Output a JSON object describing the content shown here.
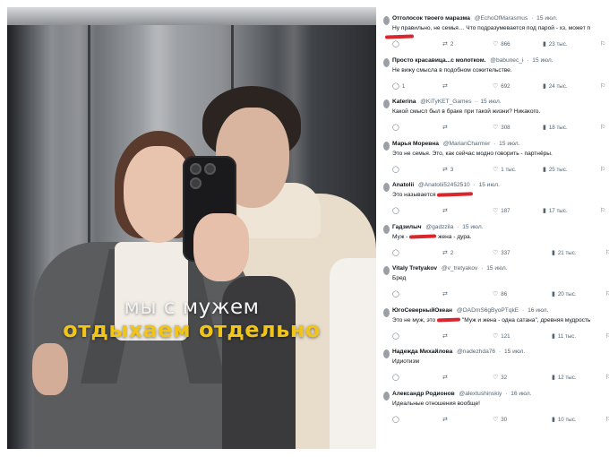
{
  "photo": {
    "caption_line1": "мы с мужем",
    "caption_line2": "отдыхаем отдельно",
    "accent_color": "#f0c419"
  },
  "replies": [
    {
      "name": "Отголосок твоего маразма",
      "handle": "@EchoOfMarasmus",
      "time": "15 июл.",
      "text": "Ну правильно, не семья… Что подразумевается под парой - хз, может п",
      "redacted": true,
      "comments": "",
      "reposts": "2",
      "likes": "866",
      "views": "23 тыс."
    },
    {
      "name": "Просто красавица...с молотком.",
      "handle": "@babunec_i",
      "time": "15 июл.",
      "text": "Не вижу смысла в подобном сожительстве.",
      "comments": "1",
      "reposts": "",
      "likes": "692",
      "views": "24 тыс."
    },
    {
      "name": "Katerina",
      "handle": "@KiTyKET_Games",
      "time": "15 июл.",
      "text": "Какой смысл был в браке при такой жизни? Никакого.",
      "comments": "",
      "reposts": "",
      "likes": "308",
      "views": "18 тыс."
    },
    {
      "name": "Марья Моревна",
      "handle": "@MarianCharmer",
      "time": "15 июл.",
      "text": "Это не семья. Это, как сейчас модно говорить - партнёры.",
      "comments": "",
      "reposts": "3",
      "likes": "1 тыс.",
      "views": "25 тыс."
    },
    {
      "name": "Anatolii",
      "handle": "@Anatolii52452510",
      "time": "15 июл.",
      "text": "Это называется",
      "redacted": true,
      "comments": "",
      "reposts": "",
      "likes": "187",
      "views": "17 тыс."
    },
    {
      "name": "Гадзилыч",
      "handle": "@gadzzila",
      "time": "15 июл.",
      "text": "Муж -",
      "redacted": true,
      "text_after": "жена - дура.",
      "comments": "",
      "reposts": "2",
      "likes": "337",
      "views": "21 тыс."
    },
    {
      "name": "Vitaly Tretyakov",
      "handle": "@v_tretyakov",
      "time": "15 июл.",
      "text": "Бред",
      "comments": "",
      "reposts": "",
      "likes": "86",
      "views": "20 тыс."
    },
    {
      "name": "ЮгоСеверныйОкеан",
      "handle": "@OADmS6gByoPTqkE",
      "time": "16 июл.",
      "text": "Это не муж, это",
      "redacted": true,
      "text_after": "\"Муж и жена - одна сатана\", древняя мудрость",
      "comments": "",
      "reposts": "",
      "likes": "121",
      "views": "11 тыс."
    },
    {
      "name": "Надежда Михайлова",
      "handle": "@nadezhda76",
      "time": "15 июл.",
      "text": "Идиотизм",
      "comments": "",
      "reposts": "",
      "likes": "32",
      "views": "12 тыс."
    },
    {
      "name": "Александр Родионов",
      "handle": "@alextushinskiy",
      "time": "16 июл.",
      "text": "Идеальные отношения вообще!",
      "comments": "",
      "reposts": "",
      "likes": "30",
      "views": "10 тыс."
    }
  ],
  "icons": {
    "comment": "comment-icon",
    "repost": "repost-icon",
    "like": "heart-icon",
    "views": "views-icon",
    "bookmark": "bookmark-icon",
    "share": "share-icon"
  },
  "colors": {
    "text": "#0f1419",
    "muted": "#536471",
    "redaction": "#d7262c"
  }
}
